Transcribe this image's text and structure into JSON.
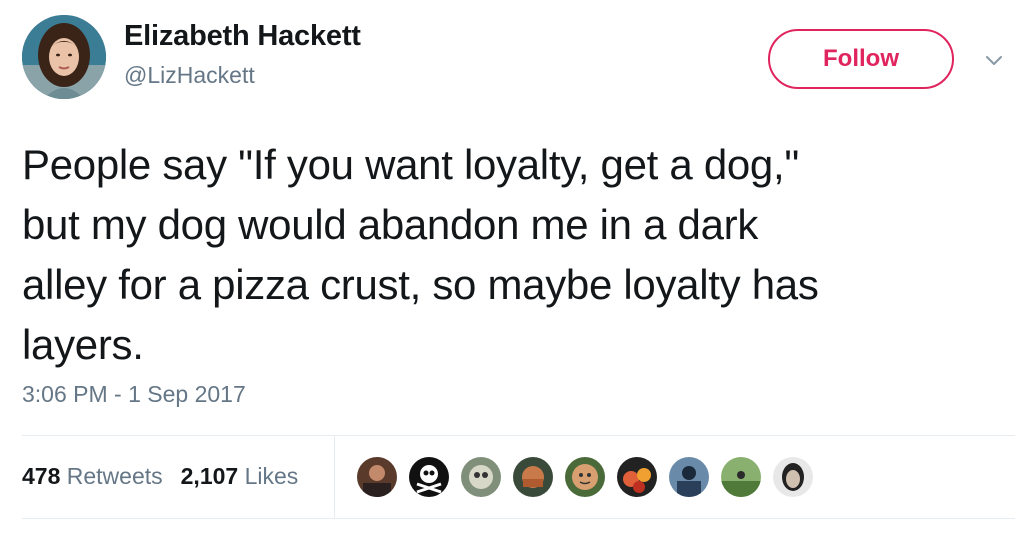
{
  "author": {
    "display_name": "Elizabeth Hackett",
    "handle": "@LizHackett",
    "avatar_icon": "profile-photo"
  },
  "follow_button": {
    "label": "Follow",
    "color": "#e0245e"
  },
  "menu_icon": "chevron-down-icon",
  "tweet": {
    "text_lines": [
      "People say \"If you want loyalty, get a dog,\"",
      "but my dog would abandon me in a dark",
      "alley for a pizza crust, so maybe loyalty has",
      "layers."
    ],
    "timestamp": "3:06 PM - 1 Sep 2017"
  },
  "stats": {
    "retweets_count": "478",
    "retweets_label": "Retweets",
    "likes_count": "2,107",
    "likes_label": "Likes"
  },
  "likers": [
    {
      "name": "liker-avatar-1",
      "color": "#5a3a2a"
    },
    {
      "name": "liker-avatar-2",
      "color": "#111111"
    },
    {
      "name": "liker-avatar-3",
      "color": "#7f8f7a"
    },
    {
      "name": "liker-avatar-4",
      "color": "#c97a4a"
    },
    {
      "name": "liker-avatar-5",
      "color": "#d8a070"
    },
    {
      "name": "liker-avatar-6",
      "color": "#e0603a"
    },
    {
      "name": "liker-avatar-7",
      "color": "#2a3f5a"
    },
    {
      "name": "liker-avatar-8",
      "color": "#4f7a3a"
    },
    {
      "name": "liker-avatar-9",
      "color": "#e8e8e8"
    }
  ],
  "colors": {
    "text": "#14171a",
    "secondary_text": "#657786",
    "accent": "#e0245e",
    "divider": "#e6ecf0"
  }
}
